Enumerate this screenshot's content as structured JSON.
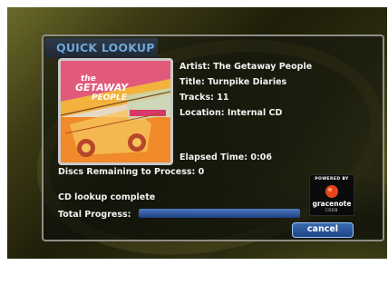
{
  "dialog": {
    "title": "QUICK LOOKUP",
    "artist": "Artist: The Getaway People",
    "title_line": "Title: Turnpike Diaries",
    "tracks": "Tracks: 11",
    "location": "Location: Internal CD",
    "elapsed": "Elapsed Time: 0:06",
    "discs_remaining": "Discs Remaining to Process: 0",
    "status": "CD lookup complete",
    "progress_label": "Total Progress:",
    "progress_value": 1.0,
    "cancel_label": "cancel"
  },
  "album_art": {
    "band_text_1": "the",
    "band_text_2": "GETAWAY",
    "band_text_3": "PEOPLE"
  },
  "logo": {
    "powered_by": "POWERED BY",
    "brand": "gracenote",
    "sub": "CDDB"
  },
  "colors": {
    "accent_blue": "#6ea7da",
    "button_blue": "#2f5ea3",
    "text_white": "#f2f2f2",
    "album_orange": "#f08a2a",
    "album_pink": "#d9366a"
  }
}
